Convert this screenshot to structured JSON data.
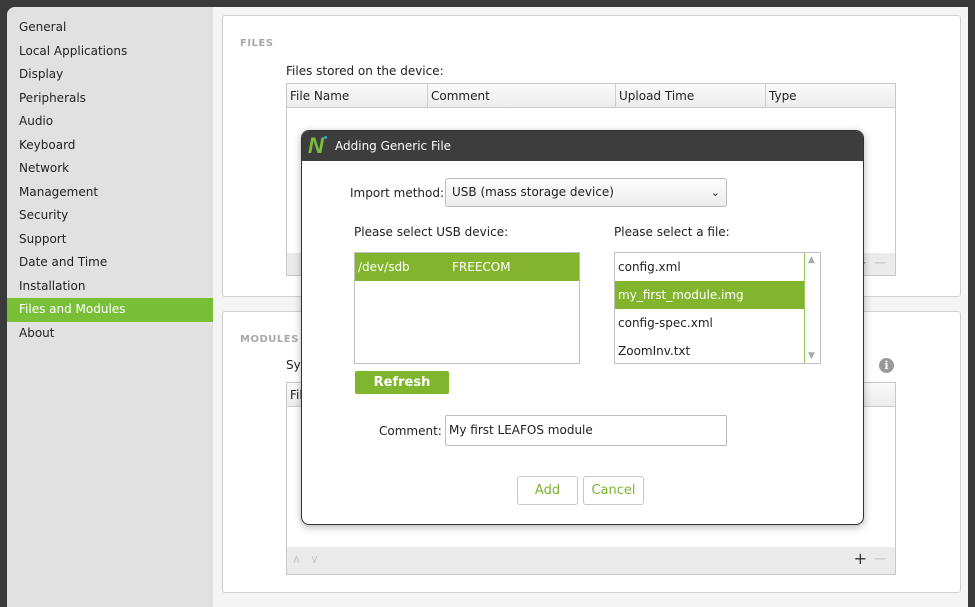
{
  "sidebar": {
    "items": [
      {
        "label": "General"
      },
      {
        "label": "Local Applications"
      },
      {
        "label": "Display"
      },
      {
        "label": "Peripherals"
      },
      {
        "label": "Audio"
      },
      {
        "label": "Keyboard"
      },
      {
        "label": "Network"
      },
      {
        "label": "Management"
      },
      {
        "label": "Security"
      },
      {
        "label": "Support"
      },
      {
        "label": "Date and Time"
      },
      {
        "label": "Installation"
      },
      {
        "label": "Files and Modules"
      },
      {
        "label": "About"
      }
    ],
    "active": "Files and Modules"
  },
  "files": {
    "title": "FILES",
    "table_label": "Files stored on the device:",
    "columns": [
      "File Name",
      "Comment",
      "Upload Time",
      "Type"
    ]
  },
  "modules": {
    "title": "MODULES",
    "label_partial": "Sys",
    "column_partial": "Fil"
  },
  "dialog": {
    "title": "Adding Generic File",
    "import_label": "Import method:",
    "import_value": "USB (mass storage device)",
    "usb_label": "Please select USB device:",
    "usb_devices": [
      {
        "path": "/dev/sdb",
        "name": "FREECOM",
        "selected": true
      }
    ],
    "file_label": "Please select a file:",
    "files": [
      {
        "name": "config.xml",
        "selected": false
      },
      {
        "name": "my_first_module.img",
        "selected": true
      },
      {
        "name": "config-spec.xml",
        "selected": false
      },
      {
        "name": "ZoomInv.txt",
        "selected": false
      }
    ],
    "refresh_label": "Refresh",
    "comment_label": "Comment:",
    "comment_value": "My first LEAFOS module",
    "add_label": "Add",
    "cancel_label": "Cancel"
  },
  "colors": {
    "accent": "#7abf38",
    "titlebar": "#3d3d3d"
  }
}
